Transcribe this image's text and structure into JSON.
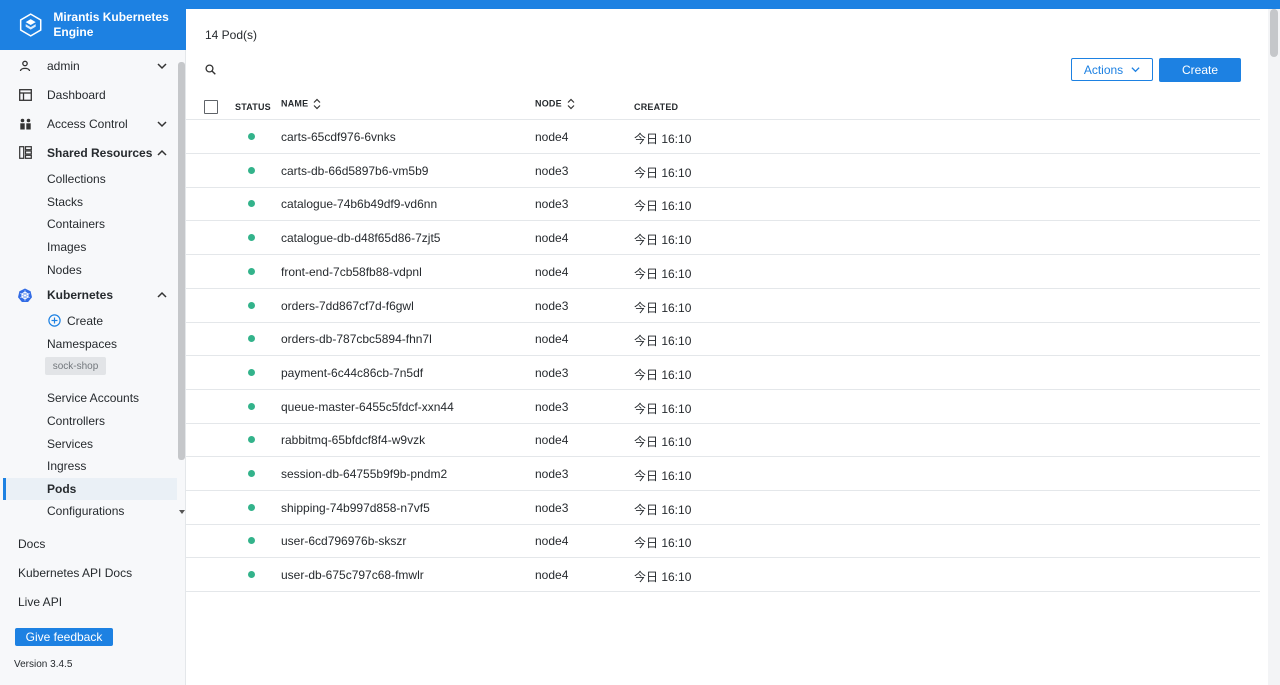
{
  "app": {
    "title": "Mirantis Kubernetes Engine",
    "version": "Version 3.4.5"
  },
  "sidebar": {
    "user": "admin",
    "dashboard": "Dashboard",
    "access_control": "Access Control",
    "shared_resources": {
      "label": "Shared Resources",
      "items": [
        "Collections",
        "Stacks",
        "Containers",
        "Images",
        "Nodes"
      ]
    },
    "kubernetes": {
      "label": "Kubernetes",
      "create": "Create",
      "namespaces": "Namespaces",
      "namespace_tag": "sock-shop",
      "items": [
        "Service Accounts",
        "Controllers",
        "Services",
        "Ingress",
        "Pods",
        "Configurations"
      ],
      "active_item": "Pods"
    },
    "bottom_links": [
      "Docs",
      "Kubernetes API Docs",
      "Live API"
    ],
    "feedback_label": "Give feedback"
  },
  "main": {
    "pod_count": "14 Pod(s)",
    "actions_label": "Actions",
    "create_label": "Create",
    "columns": {
      "status": "STATUS",
      "name": "NAME",
      "node": "NODE",
      "created": "CREATED"
    },
    "status_color": "#33b38b",
    "rows": [
      {
        "name": "carts-65cdf976-6vnks",
        "node": "node4",
        "created": "今日 16:10"
      },
      {
        "name": "carts-db-66d5897b6-vm5b9",
        "node": "node3",
        "created": "今日 16:10"
      },
      {
        "name": "catalogue-74b6b49df9-vd6nn",
        "node": "node3",
        "created": "今日 16:10"
      },
      {
        "name": "catalogue-db-d48f65d86-7zjt5",
        "node": "node4",
        "created": "今日 16:10"
      },
      {
        "name": "front-end-7cb58fb88-vdpnl",
        "node": "node4",
        "created": "今日 16:10"
      },
      {
        "name": "orders-7dd867cf7d-f6gwl",
        "node": "node3",
        "created": "今日 16:10"
      },
      {
        "name": "orders-db-787cbc5894-fhn7l",
        "node": "node4",
        "created": "今日 16:10"
      },
      {
        "name": "payment-6c44c86cb-7n5df",
        "node": "node3",
        "created": "今日 16:10"
      },
      {
        "name": "queue-master-6455c5fdcf-xxn44",
        "node": "node3",
        "created": "今日 16:10"
      },
      {
        "name": "rabbitmq-65bfdcf8f4-w9vzk",
        "node": "node4",
        "created": "今日 16:10"
      },
      {
        "name": "session-db-64755b9f9b-pndm2",
        "node": "node3",
        "created": "今日 16:10"
      },
      {
        "name": "shipping-74b997d858-n7vf5",
        "node": "node3",
        "created": "今日 16:10"
      },
      {
        "name": "user-6cd796976b-skszr",
        "node": "node4",
        "created": "今日 16:10"
      },
      {
        "name": "user-db-675c797c68-fmwlr",
        "node": "node4",
        "created": "今日 16:10"
      }
    ]
  },
  "colors": {
    "accent": "#1d81e2",
    "status_running": "#33b38b"
  }
}
